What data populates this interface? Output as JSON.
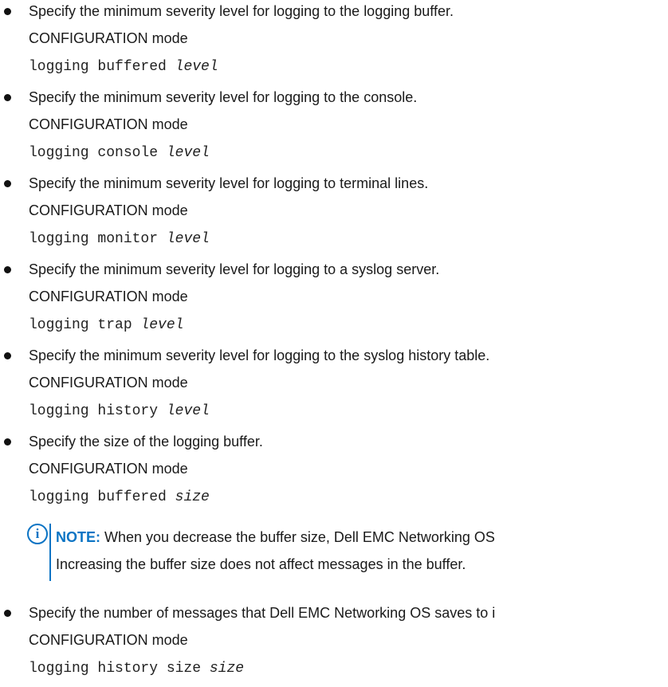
{
  "items": [
    {
      "description": "Specify the minimum severity level for logging to the logging buffer.",
      "mode": "CONFIGURATION mode",
      "command": "logging buffered",
      "argument": "level"
    },
    {
      "description": "Specify the minimum severity level for logging to the console.",
      "mode": "CONFIGURATION mode",
      "command": "logging console",
      "argument": "level"
    },
    {
      "description": "Specify the minimum severity level for logging to terminal lines.",
      "mode": "CONFIGURATION mode",
      "command": "logging monitor",
      "argument": "level"
    },
    {
      "description": "Specify the minimum severity level for logging to a syslog server.",
      "mode": "CONFIGURATION mode",
      "command": "logging trap",
      "argument": "level"
    },
    {
      "description": "Specify the minimum severity level for logging to the syslog history table.",
      "mode": "CONFIGURATION mode",
      "command": "logging history",
      "argument": "level"
    },
    {
      "description": "Specify the size of the logging buffer.",
      "mode": "CONFIGURATION mode",
      "command": "logging buffered",
      "argument": "size"
    },
    {
      "description": "Specify the number of messages that Dell EMC Networking OS saves to i",
      "mode": "CONFIGURATION mode",
      "command": "logging history size",
      "argument": "size"
    }
  ],
  "note": {
    "label": "NOTE:",
    "line1": " When you decrease the buffer size, Dell EMC Networking OS",
    "line2": "Increasing the buffer size does not affect messages in the buffer."
  }
}
